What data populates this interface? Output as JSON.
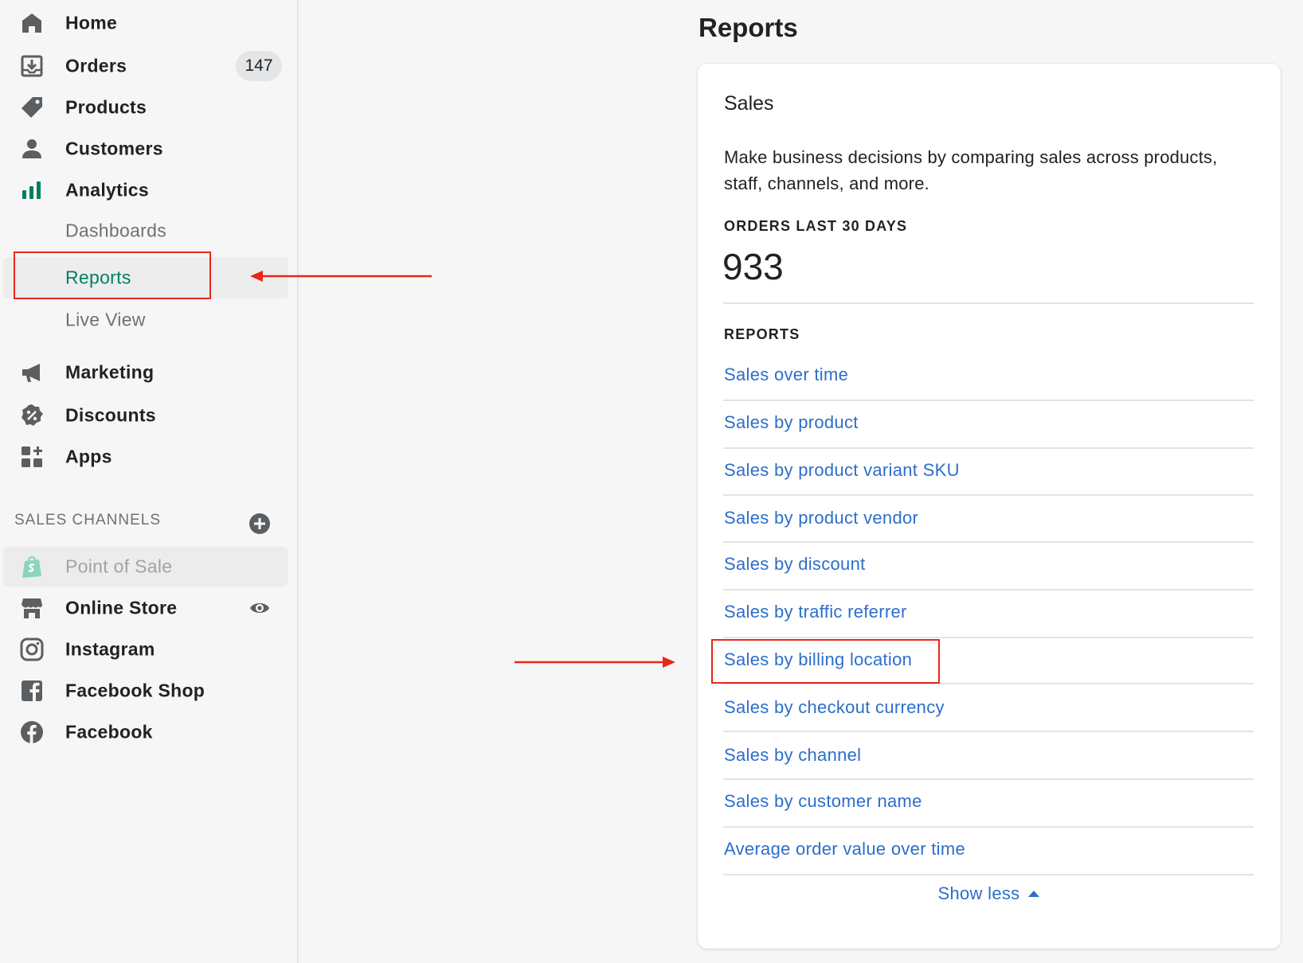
{
  "sidebar": {
    "items": [
      {
        "label": "Home",
        "icon": "home-icon"
      },
      {
        "label": "Orders",
        "icon": "orders-icon",
        "badge": "147"
      },
      {
        "label": "Products",
        "icon": "tag-icon"
      },
      {
        "label": "Customers",
        "icon": "person-icon"
      },
      {
        "label": "Analytics",
        "icon": "bar-chart-icon"
      }
    ],
    "analytics_sub": [
      {
        "label": "Dashboards"
      },
      {
        "label": "Reports",
        "active": true
      },
      {
        "label": "Live View"
      }
    ],
    "items2": [
      {
        "label": "Marketing",
        "icon": "megaphone-icon"
      },
      {
        "label": "Discounts",
        "icon": "discount-icon"
      },
      {
        "label": "Apps",
        "icon": "apps-icon"
      }
    ],
    "sales_channels_heading": "SALES CHANNELS",
    "channels": [
      {
        "label": "Point of Sale",
        "icon": "shopify-bag-icon",
        "disabled": true
      },
      {
        "label": "Online Store",
        "icon": "store-icon"
      },
      {
        "label": "Instagram",
        "icon": "instagram-icon"
      },
      {
        "label": "Facebook Shop",
        "icon": "facebook-square-icon"
      },
      {
        "label": "Facebook",
        "icon": "facebook-circle-icon"
      }
    ]
  },
  "main": {
    "title": "Reports",
    "card": {
      "title": "Sales",
      "description": "Make business decisions by comparing sales across products, staff, channels, and more.",
      "metric_label": "ORDERS LAST 30 DAYS",
      "metric_value": "933",
      "reports_label": "REPORTS",
      "reports": [
        "Sales over time",
        "Sales by product",
        "Sales by product variant SKU",
        "Sales by product vendor",
        "Sales by discount",
        "Sales by traffic referrer",
        "Sales by billing location",
        "Sales by checkout currency",
        "Sales by channel",
        "Sales by customer name",
        "Average order value over time"
      ],
      "show_less": "Show less"
    }
  },
  "colors": {
    "accent_green": "#007f5f",
    "link_blue": "#2c6ecb",
    "annotation_red": "#e8261a"
  }
}
